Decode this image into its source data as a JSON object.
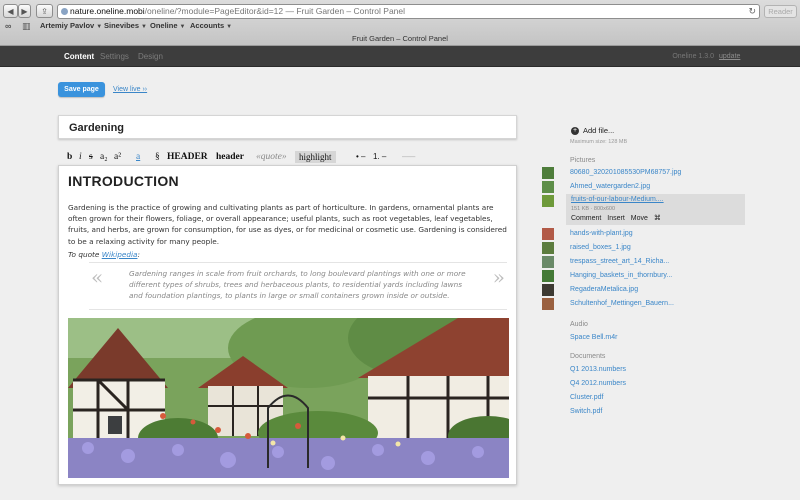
{
  "browser": {
    "url_host": "nature.oneline.mobi",
    "url_path": "/oneline/?module=PageEditor&id=12 — Fruit Garden – Control Panel",
    "reader_label": "Reader",
    "tab_title": "Fruit Garden – Control Panel",
    "bookmarks": [
      "Artemiy Pavlov",
      "Sinevibes",
      "Oneline",
      "Accounts"
    ]
  },
  "app_nav": {
    "tabs": [
      "Content",
      "Settings",
      "Design"
    ],
    "version": "Oneline 1.3.0",
    "update_label": "update"
  },
  "toolbar": {
    "save_label": "Save page",
    "view_live_label": "View live ››"
  },
  "page_title": "Gardening",
  "format_tools": {
    "bold": "b",
    "italic": "i",
    "strike": "s",
    "subscript": "a₂",
    "superscript": "a²",
    "link": "a",
    "section": "§",
    "header_upper": "HEADER",
    "header_lower": "header",
    "quote": "«quote»",
    "highlight": "highlight",
    "bullet_list": "• –",
    "numbered_list": "1. –",
    "divider": "–––"
  },
  "editor": {
    "heading": "INTRODUCTION",
    "paragraph": "Gardening is the practice of growing and cultivating plants as part of horticulture. In gardens, ornamental plants are often grown for their flowers, foliage, or overall appearance; useful plants, such as root vegetables, leaf vegetables, fruits, and herbs, are grown for consumption, for use as dyes, or for medicinal or cosmetic use. Gardening is considered to be a relaxing activity for many people.",
    "quote_prefix": "To quote ",
    "quote_link": "Wikipedia",
    "quote_suffix": ":",
    "blockquote": "Gardening ranges in scale from fruit orchards, to long boulevard plantings with one or more different types of shrubs, trees and herbaceous plants, to residential yards including lawns and foundation plantings, to plants in large or small containers grown inside or outside.",
    "quote_open": "«",
    "quote_close": "»"
  },
  "files": {
    "add_label": "Add file...",
    "max_size": "Maximum size: 128 MB",
    "sections": {
      "pictures": "Pictures",
      "audio": "Audio",
      "documents": "Documents"
    },
    "pictures": [
      "80680_320201085530PM68757.jpg",
      "Ahmed_watergarden2.jpg",
      "fruits-of-our-labour-Medium....",
      "hands-with-plant.jpg",
      "raised_boxes_1.jpg",
      "trespass_street_art_14_Richa...",
      "Hanging_baskets_in_thornbury...",
      "RegaderaMetalica.jpg",
      "Schultenhof_Mettingen_Bauern..."
    ],
    "selected": {
      "meta": "151 KB · 800x600",
      "actions": [
        "Comment",
        "Insert",
        "Move",
        "⌘"
      ]
    },
    "audio": [
      "Space Bell.m4r"
    ],
    "documents": [
      "Q1 2013.numbers",
      "Q4 2012.numbers",
      "Cluster.pdf",
      "Switch.pdf"
    ]
  },
  "colors": {
    "accent": "#3a93dd",
    "link": "#3a86c8",
    "nav_bg": "#3d3d3d"
  }
}
